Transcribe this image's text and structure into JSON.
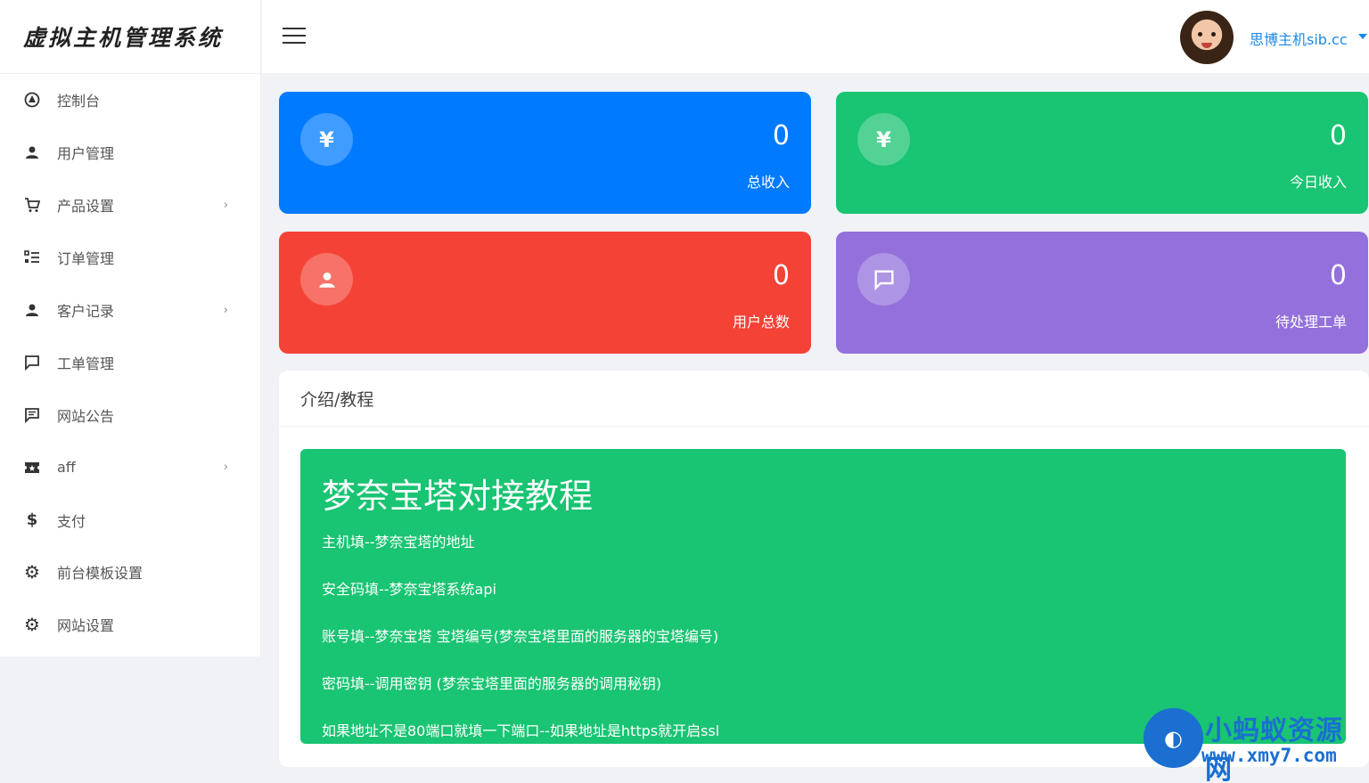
{
  "sidebar": {
    "brand": "虚拟主机管理系统",
    "items": [
      {
        "label": "控制台",
        "icon": "dashboard-icon",
        "has_submenu": false
      },
      {
        "label": "用户管理",
        "icon": "user-icon",
        "has_submenu": false
      },
      {
        "label": "产品设置",
        "icon": "cart-icon",
        "has_submenu": true
      },
      {
        "label": "订单管理",
        "icon": "list-icon",
        "has_submenu": false
      },
      {
        "label": "客户记录",
        "icon": "user-icon",
        "has_submenu": true
      },
      {
        "label": "工单管理",
        "icon": "chat-icon",
        "has_submenu": false
      },
      {
        "label": "网站公告",
        "icon": "announcement-icon",
        "has_submenu": false
      },
      {
        "label": "aff",
        "icon": "ticket-icon",
        "has_submenu": true
      },
      {
        "label": "支付",
        "icon": "dollar-icon",
        "has_submenu": false
      },
      {
        "label": "前台模板设置",
        "icon": "gear-icon",
        "has_submenu": false
      },
      {
        "label": "网站设置",
        "icon": "gear-icon",
        "has_submenu": false
      }
    ]
  },
  "header": {
    "user_name": "思博主机sib.cc"
  },
  "stats": [
    {
      "value": "0",
      "label": "总收入",
      "icon": "yen-icon",
      "color": "#007bff"
    },
    {
      "value": "0",
      "label": "今日收入",
      "icon": "yen-icon",
      "color": "#19c472"
    },
    {
      "value": "0",
      "label": "用户总数",
      "icon": "user-icon",
      "color": "#f44336"
    },
    {
      "value": "0",
      "label": "待处理工单",
      "icon": "chat-icon",
      "color": "#9370db"
    }
  ],
  "intro": {
    "title": "介绍/教程",
    "tutorial_heading": "梦奈宝塔对接教程",
    "lines": [
      "主机填--梦奈宝塔的地址",
      "安全码填--梦奈宝塔系统api",
      "账号填--梦奈宝塔 宝塔编号(梦奈宝塔里面的服务器的宝塔编号)",
      "密码填--调用密钥 (梦奈宝塔里面的服务器的调用秘钥)",
      "如果地址不是80端口就填一下端口--如果地址是https就开启ssl"
    ]
  },
  "watermark": {
    "name": "小蚂蚁资源网",
    "url": "www.xmy7.com"
  }
}
